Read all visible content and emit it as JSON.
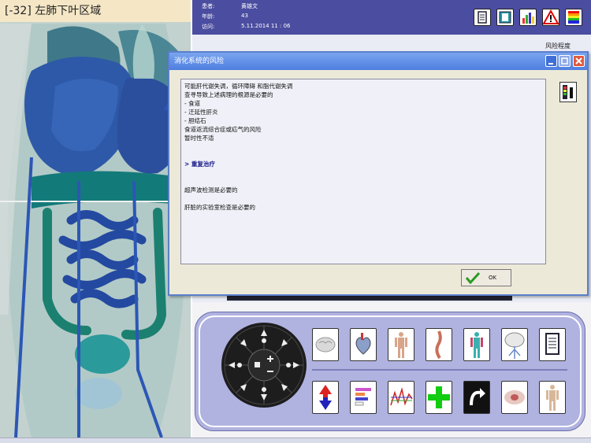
{
  "viewer": {
    "title": "[-32] 左肺下叶区域"
  },
  "patient": {
    "name_label": "患者:",
    "name": "黄雄文",
    "age_label": "年龄:",
    "age": "43",
    "visit_label": "访问:",
    "visit": "5.11.2014  11 : 06"
  },
  "header_icons": [
    "document-icon",
    "contents-icon",
    "bar-chart-icon",
    "warning-icon",
    "color-scale-icon"
  ],
  "risk_label": "风险程度",
  "dialog": {
    "title": "消化系统的风险",
    "lines": [
      "可能肝代谢失调，循环障碍 和脂代谢失调",
      "查寻导致上述病理的根源是必要的",
      "- 食道",
      "- 迁延性肝炎",
      "- 胆结石",
      "食道返流综合症或疝气的风险",
      "暂时性不适"
    ],
    "heading": "> 重复治疗",
    "note_1": "超声波检测是必要的",
    "note_2": "肝脏的实验室检查是必要的",
    "ok_label": "OK"
  },
  "colors": {
    "header_bg": "#4b4da0",
    "dialog_title": "#5a86e4",
    "panel_bg": "#b0b2e0",
    "ok_check": "#2a9a22"
  },
  "toolbar": {
    "row1": [
      "brain-icon",
      "heart-icon",
      "body-skin-icon",
      "spine-icon",
      "body-muscles-icon",
      "nervous-system-icon",
      "report-icon"
    ],
    "row2": [
      "up-down-arrows-icon",
      "bar-spectrum-icon",
      "graph-icon",
      "green-cross-icon",
      "rotate-icon",
      "pelvis-icon",
      "full-body-icon"
    ]
  }
}
